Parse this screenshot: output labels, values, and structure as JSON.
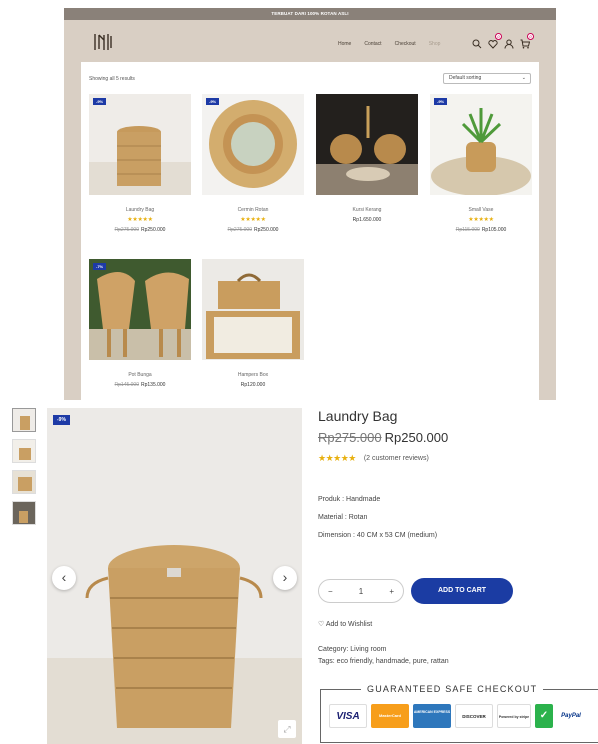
{
  "topbar": {
    "text": "TERBUAT DARI 100% ROTAN ASLI"
  },
  "nav": {
    "home": "Home",
    "contact": "Contact",
    "checkout": "Checkout",
    "shop": "Shop"
  },
  "badges": {
    "wishlist": "0",
    "cart": "0"
  },
  "listing": {
    "result_count": "Showing all 5 results",
    "sort_label": "Default sorting",
    "products": [
      {
        "name": "Laundry Bag",
        "sale_tag": "-9%",
        "stars": "★★★★★",
        "old_price": "Rp275.000",
        "price": "Rp250.000"
      },
      {
        "name": "Cermin Rotan",
        "sale_tag": "-9%",
        "stars": "★★★★★",
        "old_price": "Rp275.000",
        "price": "Rp250.000"
      },
      {
        "name": "Kursi Kerang",
        "sale_tag": "",
        "stars": "",
        "old_price": "",
        "price": "Rp1.650.000"
      },
      {
        "name": "Small Vase",
        "sale_tag": "-9%",
        "stars": "★★★★★",
        "old_price": "Rp115.000",
        "price": "Rp105.000"
      },
      {
        "name": "Pot Bunga",
        "sale_tag": "-7%",
        "stars": "",
        "old_price": "Rp145.000",
        "price": "Rp135.000"
      },
      {
        "name": "Hampers Box",
        "sale_tag": "",
        "stars": "",
        "old_price": "",
        "price": "Rp120.000"
      }
    ]
  },
  "product": {
    "sale_tag": "-9%",
    "title": "Laundry Bag",
    "old_price": "Rp275.000",
    "price": "Rp250.000",
    "stars": "★★★★★",
    "reviews": "(2 customer reviews)",
    "produk": "Produk : Handmade",
    "material": "Material : Rotan",
    "dimension": "Dimension : 40 CM x 53 CM (medium)",
    "qty": "1",
    "minus": "−",
    "plus": "+",
    "add_to_cart": "ADD TO CART",
    "wishlist": "Add to Wishlist",
    "category": "Category: Living room",
    "tags": "Tags: eco friendly, handmade, pure, rattan",
    "guarantee": "GUARANTEED SAFE CHECKOUT",
    "payments": [
      "VISA",
      "MasterCard",
      "AMERICAN EXPRESS",
      "DISCOVER",
      "Powered by stripe",
      "",
      "PayPal"
    ]
  },
  "colors": {
    "accent": "#1b3ca3",
    "sale_tag": "#1d3aa6",
    "star": "#e8b00f",
    "header_bg": "#d9cfc4",
    "topbar_bg": "#8a8179"
  }
}
